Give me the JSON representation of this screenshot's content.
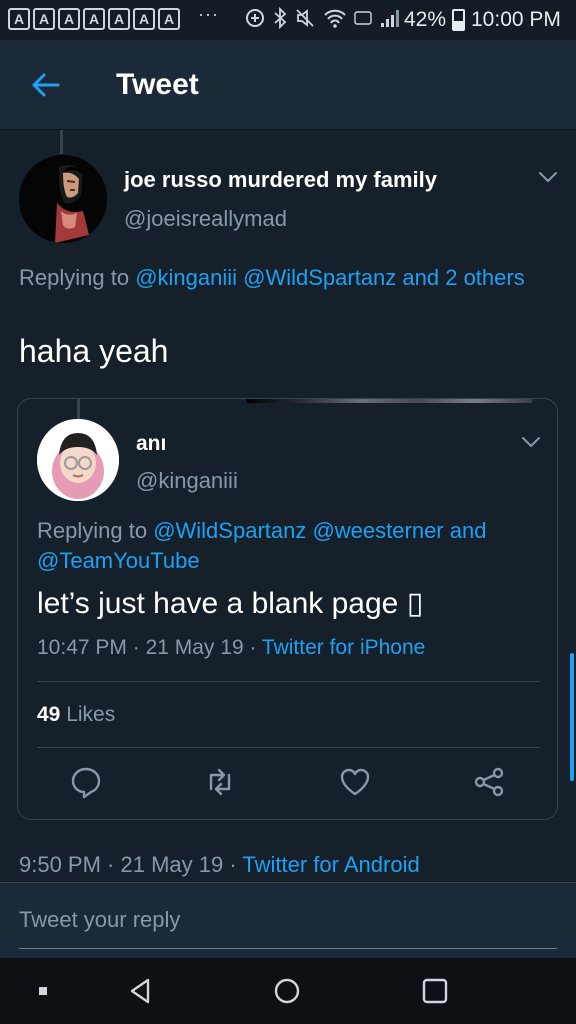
{
  "status_bar": {
    "app_icons": [
      "A",
      "A",
      "A",
      "A",
      "A",
      "A",
      "A"
    ],
    "overflow": "···",
    "battery": "42%",
    "battery_level": 0.42,
    "time": "10:00 PM"
  },
  "header": {
    "title": "Tweet"
  },
  "tweet": {
    "display_name": "joe russo murdered my family",
    "handle": "@joeisreallymad",
    "replying_prefix": "Replying to ",
    "replying_links": "@kinganiii @WildSpartanz and 2 others",
    "text": "haha yeah",
    "time": "9:50 PM",
    "sep": " · ",
    "date": "21 May 19",
    "source": "Twitter for Android"
  },
  "quoted": {
    "display_name": "anı",
    "handle": "@kinganiii",
    "replying_prefix": "Replying to ",
    "replying_links": "@WildSpartanz @weesterner and @TeamYouTube",
    "text": "let’s just have a blank page ▯",
    "time": "10:47 PM",
    "sep": " · ",
    "date": "21 May 19",
    "source": "Twitter for iPhone",
    "likes_count": "49",
    "likes_label": " Likes"
  },
  "reply": {
    "placeholder": "Tweet your reply"
  },
  "colors": {
    "accent": "#1da1f2",
    "background": "#15202b",
    "muted": "#8899a6"
  }
}
